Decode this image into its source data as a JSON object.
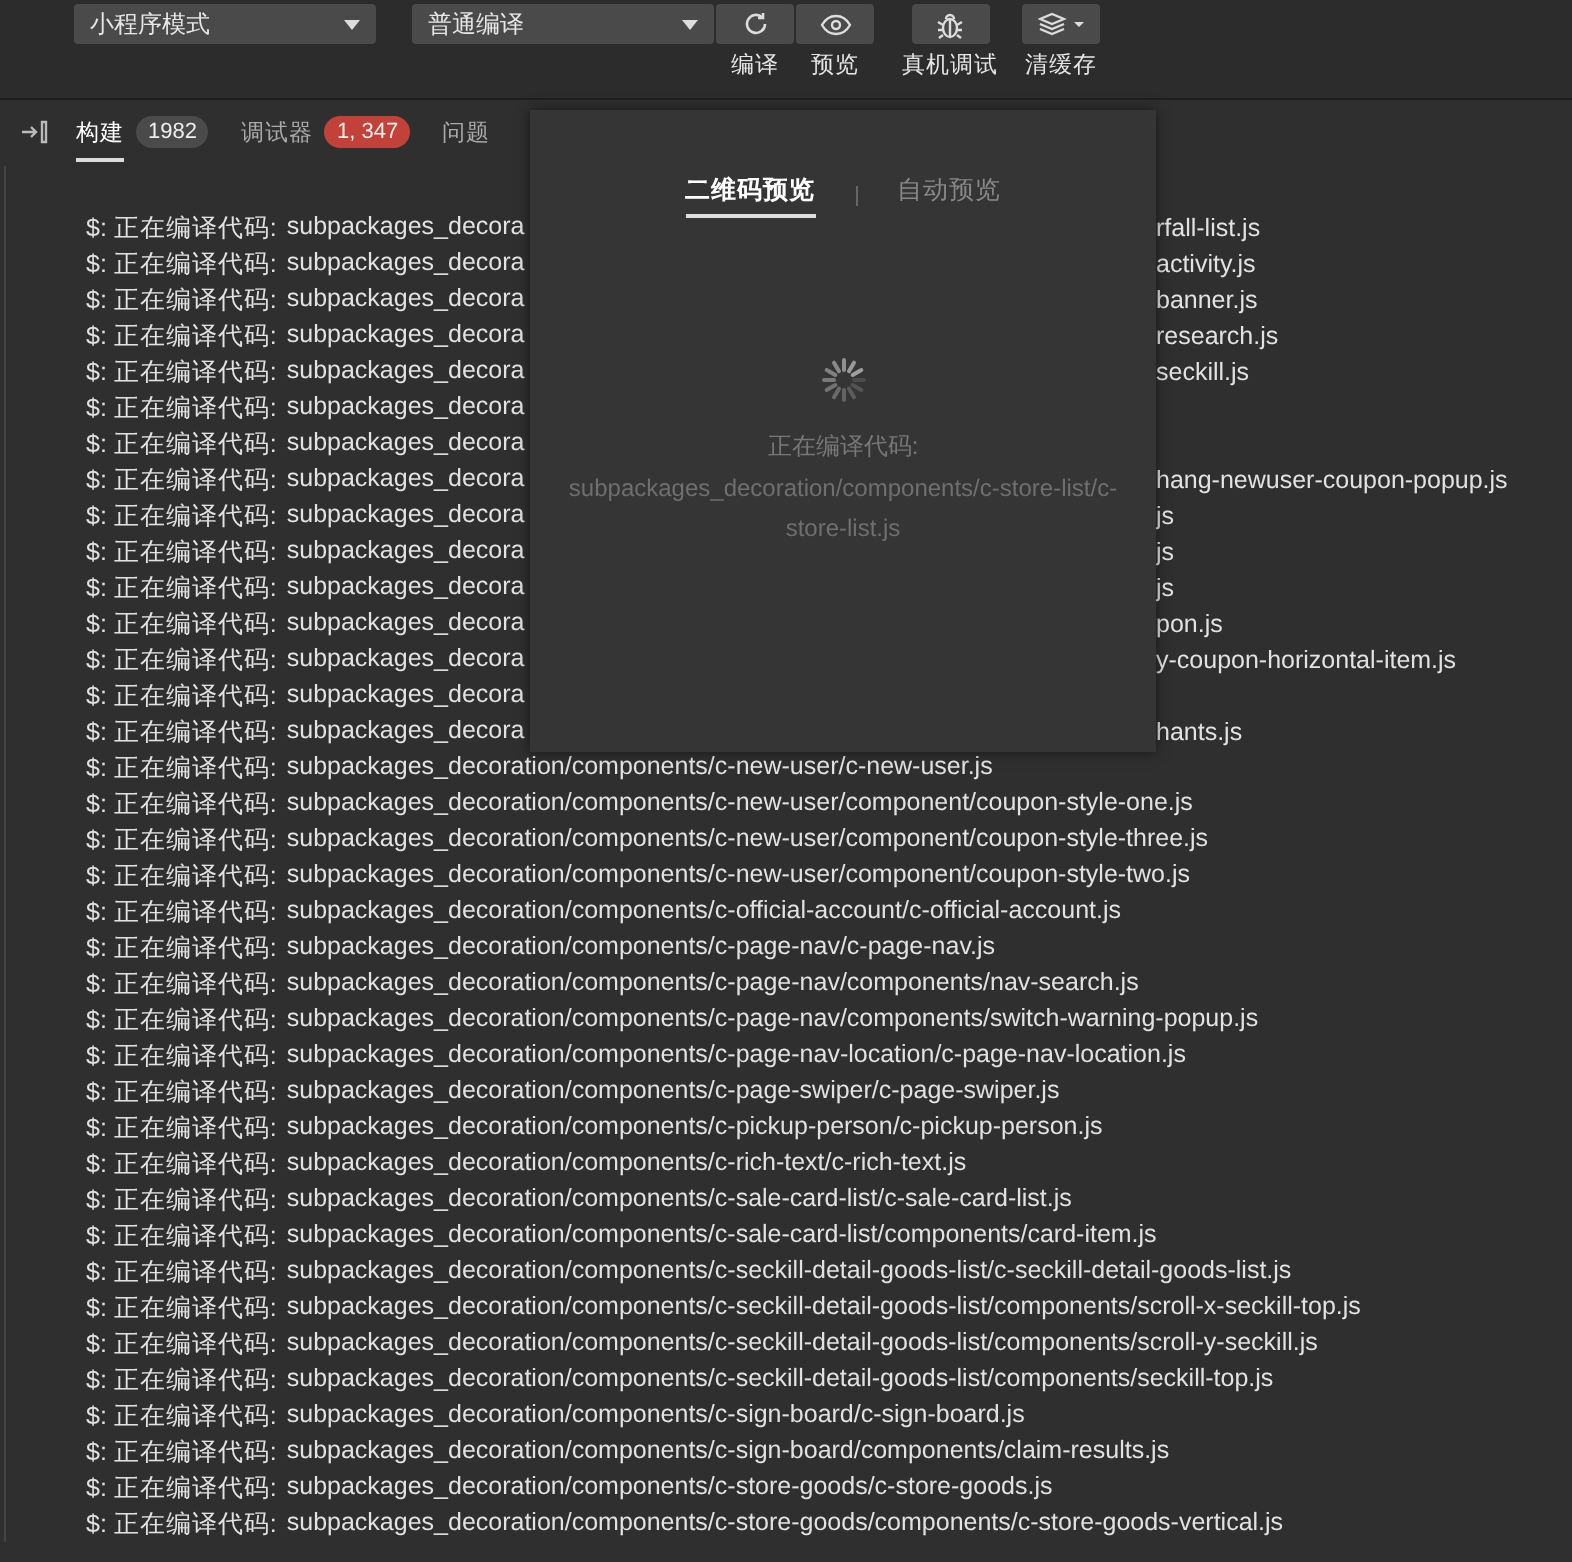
{
  "toolbar": {
    "mode_select": {
      "value": "小程序模式"
    },
    "compile_select": {
      "value": "普通编译"
    },
    "buttons": [
      {
        "kind": "refresh",
        "label": "编译"
      },
      {
        "kind": "eye",
        "label": "预览"
      },
      {
        "kind": "bug",
        "label": "真机调试"
      },
      {
        "kind": "layers",
        "label": "清缓存"
      }
    ]
  },
  "panel_tabs": [
    {
      "label": "构建",
      "badge": "1982",
      "color": "#4a4a4a",
      "selected": true
    },
    {
      "label": "调试器",
      "badge": "1, 347",
      "color": "#c2423a",
      "selected": false
    },
    {
      "label": "问题",
      "selected": false
    }
  ],
  "log_lines": [
    {
      "prefix": "$: 正在编译代码:",
      "path": "subpackages_decora",
      "tail": "rfall-list.js"
    },
    {
      "prefix": "$: 正在编译代码:",
      "path": "subpackages_decora",
      "tail": "activity.js"
    },
    {
      "prefix": "$: 正在编译代码:",
      "path": "subpackages_decora",
      "tail": "banner.js"
    },
    {
      "prefix": "$: 正在编译代码:",
      "path": "subpackages_decora",
      "tail": "research.js"
    },
    {
      "prefix": "$: 正在编译代码:",
      "path": "subpackages_decora",
      "tail": "seckill.js"
    },
    {
      "prefix": "$: 正在编译代码:",
      "path": "subpackages_decora"
    },
    {
      "prefix": "$: 正在编译代码:",
      "path": "subpackages_decora"
    },
    {
      "prefix": "$: 正在编译代码:",
      "path": "subpackages_decora",
      "tail": "hang-newuser-coupon-popup.js"
    },
    {
      "prefix": "$: 正在编译代码:",
      "path": "subpackages_decora",
      "tail": "js"
    },
    {
      "prefix": "$: 正在编译代码:",
      "path": "subpackages_decora",
      "tail": "js"
    },
    {
      "prefix": "$: 正在编译代码:",
      "path": "subpackages_decora",
      "tail": "js"
    },
    {
      "prefix": "$: 正在编译代码:",
      "path": "subpackages_decora",
      "tail": "pon.js"
    },
    {
      "prefix": "$: 正在编译代码:",
      "path": "subpackages_decora",
      "tail": "y-coupon-horizontal-item.js"
    },
    {
      "prefix": "$: 正在编译代码:",
      "path": "subpackages_decora"
    },
    {
      "prefix": "$: 正在编译代码:",
      "path": "subpackages_decora",
      "tail": "hants.js"
    },
    {
      "prefix": "$: 正在编译代码:",
      "path": "subpackages_decoration/components/c-new-user/c-new-user.js"
    },
    {
      "prefix": "$: 正在编译代码:",
      "path": "subpackages_decoration/components/c-new-user/component/coupon-style-one.js"
    },
    {
      "prefix": "$: 正在编译代码:",
      "path": "subpackages_decoration/components/c-new-user/component/coupon-style-three.js"
    },
    {
      "prefix": "$: 正在编译代码:",
      "path": "subpackages_decoration/components/c-new-user/component/coupon-style-two.js"
    },
    {
      "prefix": "$: 正在编译代码:",
      "path": "subpackages_decoration/components/c-official-account/c-official-account.js"
    },
    {
      "prefix": "$: 正在编译代码:",
      "path": "subpackages_decoration/components/c-page-nav/c-page-nav.js"
    },
    {
      "prefix": "$: 正在编译代码:",
      "path": "subpackages_decoration/components/c-page-nav/components/nav-search.js"
    },
    {
      "prefix": "$: 正在编译代码:",
      "path": "subpackages_decoration/components/c-page-nav/components/switch-warning-popup.js"
    },
    {
      "prefix": "$: 正在编译代码:",
      "path": "subpackages_decoration/components/c-page-nav-location/c-page-nav-location.js"
    },
    {
      "prefix": "$: 正在编译代码:",
      "path": "subpackages_decoration/components/c-page-swiper/c-page-swiper.js"
    },
    {
      "prefix": "$: 正在编译代码:",
      "path": "subpackages_decoration/components/c-pickup-person/c-pickup-person.js"
    },
    {
      "prefix": "$: 正在编译代码:",
      "path": "subpackages_decoration/components/c-rich-text/c-rich-text.js"
    },
    {
      "prefix": "$: 正在编译代码:",
      "path": "subpackages_decoration/components/c-sale-card-list/c-sale-card-list.js"
    },
    {
      "prefix": "$: 正在编译代码:",
      "path": "subpackages_decoration/components/c-sale-card-list/components/card-item.js"
    },
    {
      "prefix": "$: 正在编译代码:",
      "path": "subpackages_decoration/components/c-seckill-detail-goods-list/c-seckill-detail-goods-list.js"
    },
    {
      "prefix": "$: 正在编译代码:",
      "path": "subpackages_decoration/components/c-seckill-detail-goods-list/components/scroll-x-seckill-top.js"
    },
    {
      "prefix": "$: 正在编译代码:",
      "path": "subpackages_decoration/components/c-seckill-detail-goods-list/components/scroll-y-seckill.js"
    },
    {
      "prefix": "$: 正在编译代码:",
      "path": "subpackages_decoration/components/c-seckill-detail-goods-list/components/seckill-top.js"
    },
    {
      "prefix": "$: 正在编译代码:",
      "path": "subpackages_decoration/components/c-sign-board/c-sign-board.js"
    },
    {
      "prefix": "$: 正在编译代码:",
      "path": "subpackages_decoration/components/c-sign-board/components/claim-results.js"
    },
    {
      "prefix": "$: 正在编译代码:",
      "path": "subpackages_decoration/components/c-store-goods/c-store-goods.js"
    },
    {
      "prefix": "$: 正在编译代码:",
      "path": "subpackages_decoration/components/c-store-goods/components/c-store-goods-vertical.js"
    }
  ],
  "preview_popup": {
    "tabs": [
      {
        "label": "二维码预览",
        "selected": true
      },
      {
        "label": "自动预览",
        "selected": false
      }
    ],
    "status": "正在编译代码:",
    "file": "subpackages_decoration/components/c-store-list/c-store-list.js"
  }
}
